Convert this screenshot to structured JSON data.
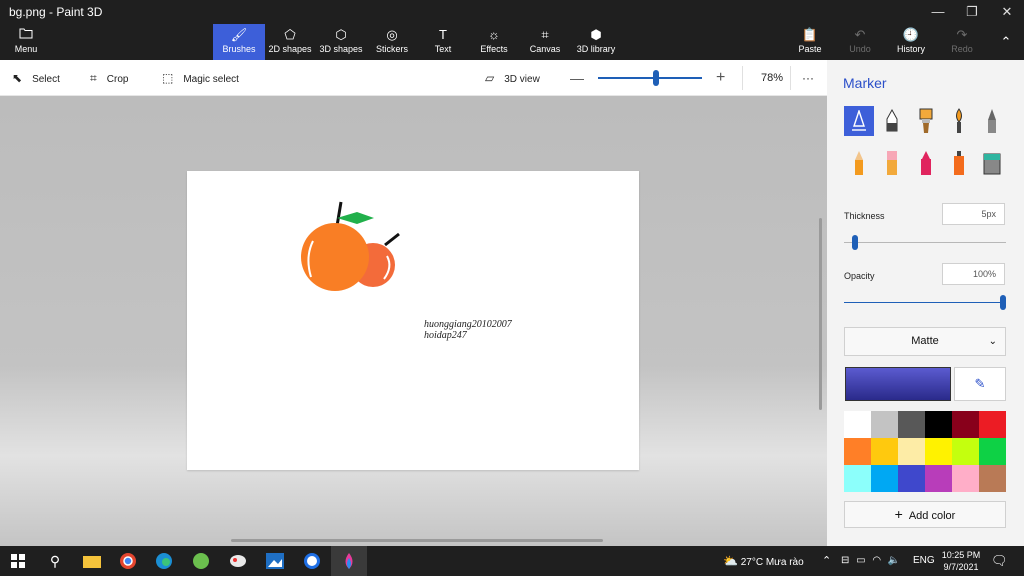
{
  "window": {
    "title": "bg.png - Paint 3D"
  },
  "ribbon": {
    "menu": "Menu",
    "tools": [
      "Brushes",
      "2D shapes",
      "3D shapes",
      "Stickers",
      "Text",
      "Effects",
      "Canvas",
      "3D library"
    ],
    "paste": "Paste",
    "undo": "Undo",
    "history": "History",
    "redo": "Redo"
  },
  "toolbar": {
    "select": "Select",
    "crop": "Crop",
    "magic_select": "Magic select",
    "view3d": "3D view",
    "zoom": "78%",
    "more": "···",
    "zoom_level": 0.56
  },
  "canvas": {
    "signature_line1": "huonggiang20102007",
    "signature_line2": "hoidap247"
  },
  "panel": {
    "title": "Marker",
    "thickness_label": "Thickness",
    "thickness_value": "5px",
    "thickness_level": 0.05,
    "opacity_label": "Opacity",
    "opacity_value": "100%",
    "opacity_level": 1.0,
    "finish": "Matte",
    "add_color": "Add color",
    "palette": [
      "#ffffff",
      "#c3c3c3",
      "#585858",
      "#000000",
      "#88001b",
      "#ec1c24",
      "#ff7f27",
      "#ffc90e",
      "#fdeca6",
      "#fff200",
      "#c4ff0e",
      "#0ed145",
      "#8cfffb",
      "#00a8f3",
      "#3f48cc",
      "#b83dba",
      "#ffaec8",
      "#b97a56"
    ],
    "accent": "#3d5fd9"
  },
  "taskbar": {
    "weather": "27°C  Mưa rào",
    "lang": "ENG",
    "time": "10:25 PM",
    "date": "9/7/2021"
  }
}
